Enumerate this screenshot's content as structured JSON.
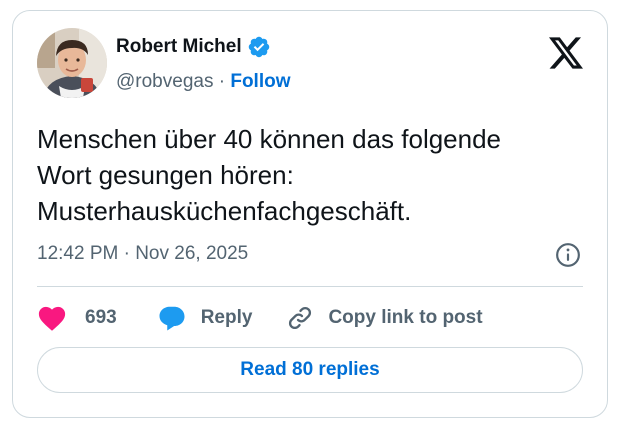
{
  "author": {
    "name": "Robert Michel",
    "handle": "@robvegas",
    "separator": "·",
    "follow_label": "Follow",
    "verified": true
  },
  "tweet": {
    "text": "Menschen über 40 können das folgende\nWort gesungen hören:\nMusterhausküchenfachgeschäft.",
    "timestamp": "12:42 PM · Nov 26, 2025"
  },
  "actions": {
    "like_count": "693",
    "reply_label": "Reply",
    "copy_link_label": "Copy link to post"
  },
  "read_replies_label": "Read 80 replies",
  "colors": {
    "text": "#0f1419",
    "secondary": "#536471",
    "link": "#006fd6",
    "like": "#f91880",
    "reply": "#1d9bf0",
    "border": "#cfd9de"
  },
  "icons": [
    "avatar",
    "verified-badge-icon",
    "x-logo-icon",
    "info-icon",
    "heart-icon",
    "reply-bubble-icon",
    "link-icon"
  ]
}
